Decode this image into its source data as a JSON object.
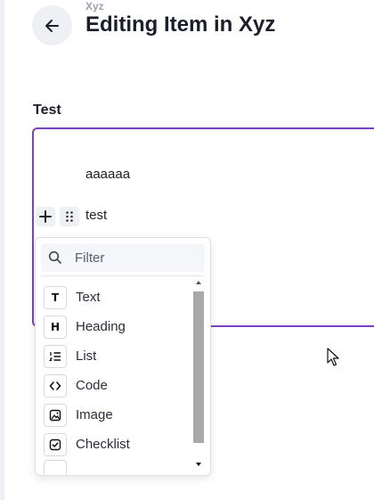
{
  "header": {
    "breadcrumb": "Xyz",
    "title": "Editing Item in Xyz",
    "back_icon": "arrow-left-icon"
  },
  "field": {
    "label": "Test"
  },
  "editor": {
    "border_color": "#7b3fc4",
    "paragraphs": [
      "aaaaaa",
      "test"
    ],
    "add_icon": "plus-icon",
    "drag_icon": "drag-handle-icon"
  },
  "block_menu": {
    "filter_placeholder": "Filter",
    "filter_icon": "search-icon",
    "items": [
      {
        "label": "Text",
        "icon": "text-icon",
        "glyph": "T"
      },
      {
        "label": "Heading",
        "icon": "heading-icon",
        "glyph": "H"
      },
      {
        "label": "List",
        "icon": "list-icon"
      },
      {
        "label": "Code",
        "icon": "code-icon"
      },
      {
        "label": "Image",
        "icon": "image-icon"
      },
      {
        "label": "Checklist",
        "icon": "checklist-icon"
      }
    ]
  }
}
